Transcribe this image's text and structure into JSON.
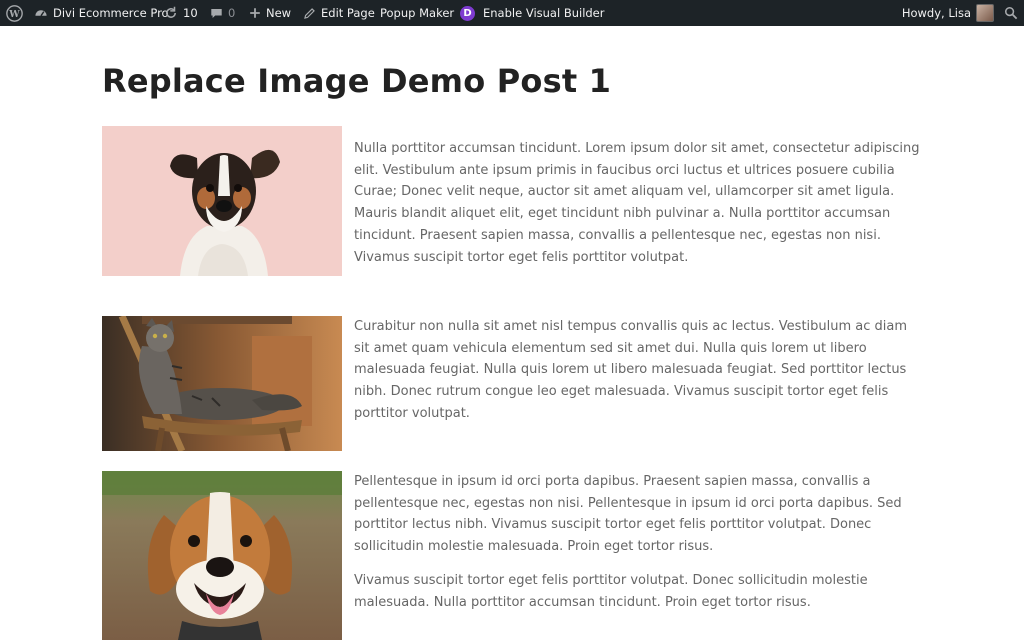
{
  "adminbar": {
    "site_name": "Divi Ecommerce Pro",
    "updates_count": "10",
    "comments_count": "0",
    "new_label": "New",
    "edit_label": "Edit Page",
    "popup_label": "Popup Maker",
    "visual_builder_label": "Enable Visual Builder",
    "divi_badge": "D",
    "howdy_label": "Howdy, Lisa",
    "icons": [
      "wordpress-logo-icon",
      "dashboard-icon",
      "updates-icon",
      "comment-icon",
      "plus-icon",
      "pencil-icon",
      "divi-icon",
      "avatar",
      "search-icon"
    ],
    "background_color": "#1d2327"
  },
  "post": {
    "title": "Replace Image Demo Post 1",
    "blocks": [
      {
        "image": "terrier-dog-photo",
        "paragraphs": [
          "Nulla porttitor accumsan tincidunt. Lorem ipsum dolor sit amet, consectetur adipiscing elit. Vestibulum ante ipsum primis in faucibus orci luctus et ultrices posuere cubilia Curae; Donec velit neque, auctor sit amet aliquam vel, ullamcorper sit amet ligula. Mauris blandit aliquet elit, eget tincidunt nibh pulvinar a. Nulla porttitor accumsan tincidunt. Praesent sapien massa, convallis a pellentesque nec, egestas non nisi. Vivamus suscipit tortor eget felis porttitor volutpat."
        ]
      },
      {
        "image": "tabby-cat-on-chair-photo",
        "paragraphs": [
          "Curabitur non nulla sit amet nisl tempus convallis quis ac lectus. Vestibulum ac diam sit amet quam vehicula elementum sed sit amet dui. Nulla quis lorem ut libero malesuada feugiat. Nulla quis lorem ut libero malesuada feugiat. Sed porttitor lectus nibh. Donec rutrum congue leo eget malesuada. Vivamus suscipit tortor eget felis porttitor volutpat."
        ]
      },
      {
        "image": "beagle-dog-photo",
        "paragraphs": [
          "Pellentesque in ipsum id orci porta dapibus. Praesent sapien massa, convallis a pellentesque nec, egestas non nisi. Pellentesque in ipsum id orci porta dapibus. Sed porttitor lectus nibh. Vivamus suscipit tortor eget felis porttitor volutpat. Donec sollicitudin molestie malesuada. Proin eget tortor risus.",
          "Vivamus suscipit tortor eget felis porttitor volutpat. Donec sollicitudin molestie malesuada. Nulla porttitor accumsan tincidunt. Proin eget tortor risus."
        ]
      }
    ]
  }
}
